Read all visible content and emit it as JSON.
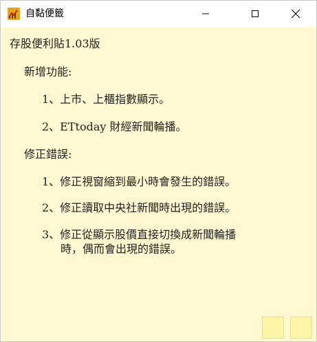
{
  "window": {
    "title": "自黏便籤"
  },
  "note": {
    "heading": "存股便利貼1.03版",
    "section_new": "新增功能:",
    "new_items": [
      "1、上市、上櫃指數顯示。",
      "2、ETtoday 財經新聞輪播。"
    ],
    "section_fix": "修正錯誤:",
    "fix_items": [
      "1、修正視窗縮到最小時會發生的錯誤。",
      "2、修正讀取中央社新聞時出現的錯誤。",
      "3、修正從顯示股價直接切換成新聞輪播"
    ],
    "fix_item3_cont": "時，偶而會出現的錯誤。"
  },
  "colors": {
    "note_background": "#fff8d0",
    "corner_button": "#fdf4a8"
  }
}
